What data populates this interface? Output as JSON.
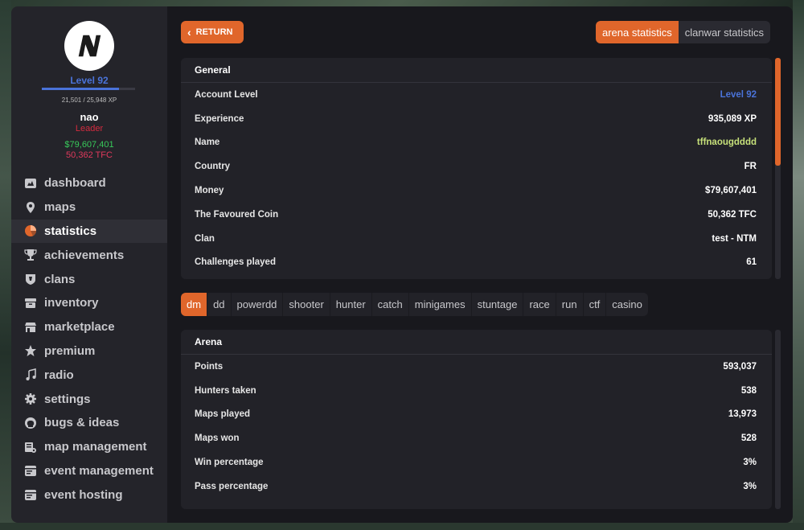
{
  "colors": {
    "accent": "#e0662b",
    "level_blue": "#4a73d9",
    "leader_red": "#d42b3f",
    "money_green": "#38c95a",
    "tfc_pink": "#e0395c",
    "name_green": "#c6e07a"
  },
  "profile": {
    "avatar_letter": "N",
    "level": "Level 92",
    "xp_text": "21,501 / 25,948 XP",
    "xp_progress": 0.83,
    "name": "nao",
    "role": "Leader",
    "money": "$79,607,401",
    "tfc": "50,362 TFC"
  },
  "nav": [
    {
      "label": "dashboard",
      "icon": "dashboard-icon"
    },
    {
      "label": "maps",
      "icon": "map-pin-icon"
    },
    {
      "label": "statistics",
      "icon": "pie-chart-icon",
      "active": true
    },
    {
      "label": "achievements",
      "icon": "trophy-icon"
    },
    {
      "label": "clans",
      "icon": "shield-icon"
    },
    {
      "label": "inventory",
      "icon": "box-icon"
    },
    {
      "label": "marketplace",
      "icon": "store-icon"
    },
    {
      "label": "premium",
      "icon": "star-icon"
    },
    {
      "label": "radio",
      "icon": "music-note-icon"
    },
    {
      "label": "settings",
      "icon": "gear-icon"
    },
    {
      "label": "bugs & ideas",
      "icon": "github-icon"
    },
    {
      "label": "map management",
      "icon": "map-stack-icon"
    },
    {
      "label": "event management",
      "icon": "calendar-icon"
    },
    {
      "label": "event hosting",
      "icon": "calendar-icon"
    }
  ],
  "header": {
    "return_label": "RETURN",
    "tabs": [
      "arena statistics",
      "clanwar statistics"
    ]
  },
  "general": {
    "title": "General",
    "rows": [
      {
        "label": "Account Level",
        "value": "Level 92"
      },
      {
        "label": "Experience",
        "value": "935,089 XP"
      },
      {
        "label": "Name",
        "value": "tffnaougdddd"
      },
      {
        "label": "Country",
        "value": "FR"
      },
      {
        "label": "Money",
        "value": "$79,607,401"
      },
      {
        "label": "The Favoured Coin",
        "value": "50,362 TFC"
      },
      {
        "label": "Clan",
        "value": "test - NTM"
      },
      {
        "label": "Challenges played",
        "value": "61"
      }
    ]
  },
  "modes": [
    "dm",
    "dd",
    "powerdd",
    "shooter",
    "hunter",
    "catch",
    "minigames",
    "stuntage",
    "race",
    "run",
    "ctf",
    "casino"
  ],
  "arena": {
    "title": "Arena",
    "rows": [
      {
        "label": "Points",
        "value": "593,037"
      },
      {
        "label": "Hunters taken",
        "value": "538"
      },
      {
        "label": "Maps played",
        "value": "13,973"
      },
      {
        "label": "Maps won",
        "value": "528"
      },
      {
        "label": "Win percentage",
        "value": "3%"
      },
      {
        "label": "Pass percentage",
        "value": "3%"
      }
    ]
  }
}
